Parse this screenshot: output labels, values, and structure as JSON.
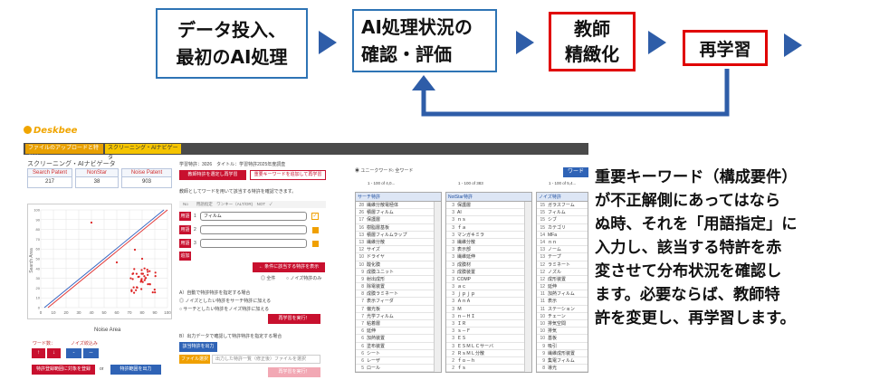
{
  "workflow": {
    "step1": [
      "データ投入、",
      "最初のAI処理"
    ],
    "step2": [
      "AI処理状況の",
      "確認・評価"
    ],
    "step3": [
      "教師",
      "精緻化"
    ],
    "step4": "再学習",
    "colors": {
      "flow_border": "#2e74b5",
      "highlight_border": "#e00000",
      "arrow": "#2e5da8"
    }
  },
  "app": {
    "logo": "Deskbee",
    "tabs": [
      "ファイルのアップロードと特徴付け",
      "スクリーニング・AIナビゲータ"
    ],
    "navigator_title": "スクリーニング・AIナビゲータ",
    "stats": [
      {
        "label": "Search Patent",
        "value": "217"
      },
      {
        "label": "NonStar",
        "value": "38"
      },
      {
        "label": "Noise Patent",
        "value": "903"
      }
    ],
    "file_info": "学習特許：3026　タイトル：学習特許2025年度調査",
    "tab_buttons": [
      "教師特許を選定し再学習",
      "重要キーワードを追加して再学習"
    ],
    "instruction": "教師としてワードを用いて該当する特許を確認できます。",
    "terms": [
      {
        "label": "用語",
        "value": "フィルム"
      },
      {
        "label": "用語",
        "value": ""
      },
      {
        "label": "用語",
        "value": ""
      }
    ],
    "term_numbers": [
      "1",
      "2",
      "3"
    ],
    "add_label": "追加",
    "distribution_button": "← 条件に該当する特許を表示",
    "radio_options": [
      "全件",
      "ノイズ特許のみ"
    ],
    "step_a_title": "A）自動で特許特許を指定する場合",
    "step_a_options": [
      "ノイズとしたい特許をサーチ特許に加える",
      "サーチとしたい特許をノイズ特許に加える"
    ],
    "relearn_button": "再学習を実行！",
    "step_b_title": "B）出力データで確認して特許特許を指定する場合",
    "export_button": "該当特許を出力",
    "file_select_label": "ファイル選択",
    "file_select_placeholder": "出力した特許一覧（修正後）ファイルを選択",
    "chart_ylabel": "Search Area",
    "chart_xlabel": "Noise Area",
    "chart_xticks": [
      "0",
      "10",
      "20",
      "30",
      "40",
      "50",
      "60",
      "70",
      "80",
      "90",
      "100"
    ],
    "chart_yticks": [
      "0",
      "10",
      "20",
      "30",
      "40",
      "50",
      "60",
      "70",
      "80",
      "90",
      "100"
    ],
    "bottom_labels": [
      "ワード数：",
      "ノイズ絞込み"
    ],
    "bottom_buttons": [
      "↑",
      "↓",
      "-",
      "--"
    ],
    "bottom_actions": [
      "特許登録範囲に対象を登録",
      "特許範囲を出力"
    ],
    "legend": [
      "ユニークワード",
      "全ワード"
    ],
    "word_button": "ワード",
    "word_tables": [
      {
        "header": "サーチ特許",
        "rows": [
          [
            "28",
            "繊維分散電極体"
          ],
          [
            "26",
            "積層フィルム"
          ],
          [
            "17",
            "保護層"
          ],
          [
            "16",
            "樹脂層基板"
          ],
          [
            "13",
            "積層フィルムラップ"
          ],
          [
            "13",
            "繊維分散"
          ],
          [
            "12",
            "サイズ"
          ],
          [
            "10",
            "ドライヤ"
          ],
          [
            "10",
            "酸化膜"
          ],
          [
            "9",
            "成膜ユニット"
          ],
          [
            "9",
            "射出成形"
          ],
          [
            "8",
            "除電装置"
          ],
          [
            "8",
            "成膜ラミネート"
          ],
          [
            "7",
            "表示フィーダ"
          ],
          [
            "7",
            "偏光板"
          ],
          [
            "7",
            "光学フィルム"
          ],
          [
            "7",
            "粘着層"
          ],
          [
            "6",
            "延伸"
          ],
          [
            "6",
            "加熱装置"
          ],
          [
            "6",
            "塗布装置"
          ],
          [
            "6",
            "シート"
          ],
          [
            "6",
            "レーザ"
          ],
          [
            "5",
            "ロール"
          ],
          [
            "5",
            "搬送装置"
          ],
          [
            "4",
            "スリット"
          ]
        ]
      },
      {
        "header": "NotStar特許",
        "rows": [
          [
            "3",
            "保護層"
          ],
          [
            "3",
            "AI"
          ],
          [
            "3",
            "ｎｓ"
          ],
          [
            "3",
            "ｆａ"
          ],
          [
            "3",
            "マンガキミラ"
          ],
          [
            "3",
            "繊維分散"
          ],
          [
            "3",
            "表示部"
          ],
          [
            "3",
            "繊維延伸"
          ],
          [
            "3",
            "成膜材"
          ],
          [
            "3",
            "成膜装置"
          ],
          [
            "3",
            "COMP"
          ],
          [
            "3",
            "ａｃ"
          ],
          [
            "3",
            "ｊｐｊｐ"
          ],
          [
            "3",
            "ＡｎＡ"
          ],
          [
            "3",
            "Ｍ"
          ],
          [
            "3",
            "ｎ－ＨＩ"
          ],
          [
            "3",
            "ＩＲ"
          ],
          [
            "3",
            "ｓ－Ｆ"
          ],
          [
            "3",
            "ＥＳ"
          ],
          [
            "3",
            "ＥＳＭＬＣサーバ"
          ],
          [
            "2",
            "ＲｓＭＬ分散"
          ],
          [
            "2",
            "ｆｏ－ｈ"
          ],
          [
            "2",
            "ｆｓ"
          ],
          [
            "2",
            "ｆａ"
          ],
          [
            "2",
            "ｆｅ"
          ]
        ]
      },
      {
        "header": "ノイズ特許",
        "rows": [
          [
            "15",
            "ガラスフーム"
          ],
          [
            "15",
            "フィルム"
          ],
          [
            "15",
            "シブ"
          ],
          [
            "15",
            "カテゴリ"
          ],
          [
            "14",
            "MFa"
          ],
          [
            "14",
            "ｎｎ"
          ],
          [
            "13",
            "ノーム"
          ],
          [
            "13",
            "テープ"
          ],
          [
            "12",
            "ラミネート"
          ],
          [
            "12",
            "ノズル"
          ],
          [
            "12",
            "成形装置"
          ],
          [
            "12",
            "延伸"
          ],
          [
            "11",
            "加熱フィルム"
          ],
          [
            "11",
            "表示"
          ],
          [
            "11",
            "ステーション"
          ],
          [
            "10",
            "チェーン"
          ],
          [
            "10",
            "排気空間"
          ],
          [
            "10",
            "排気"
          ],
          [
            "10",
            "基板"
          ],
          [
            "9",
            "吸引"
          ],
          [
            "9",
            "繊維成形装置"
          ],
          [
            "9",
            "集電フィルム"
          ],
          [
            "8",
            "導光"
          ],
          [
            "8",
            "集束"
          ],
          [
            "8",
            "繊維"
          ]
        ]
      }
    ],
    "table_page_info": [
      "1 - 100 of 4,0...",
      "1 - 100 of 383",
      "1 - 100 of 5,4..."
    ]
  },
  "description": [
    "重要キーワード（構成要件）",
    "が不正解側にあってはなら",
    "ぬ時、それを「用語指定」に",
    "入力し、該当する特許を赤",
    "変させて分布状況を確認し",
    "ます。必要ならば、教師特",
    "許を変更し、再学習します。"
  ]
}
